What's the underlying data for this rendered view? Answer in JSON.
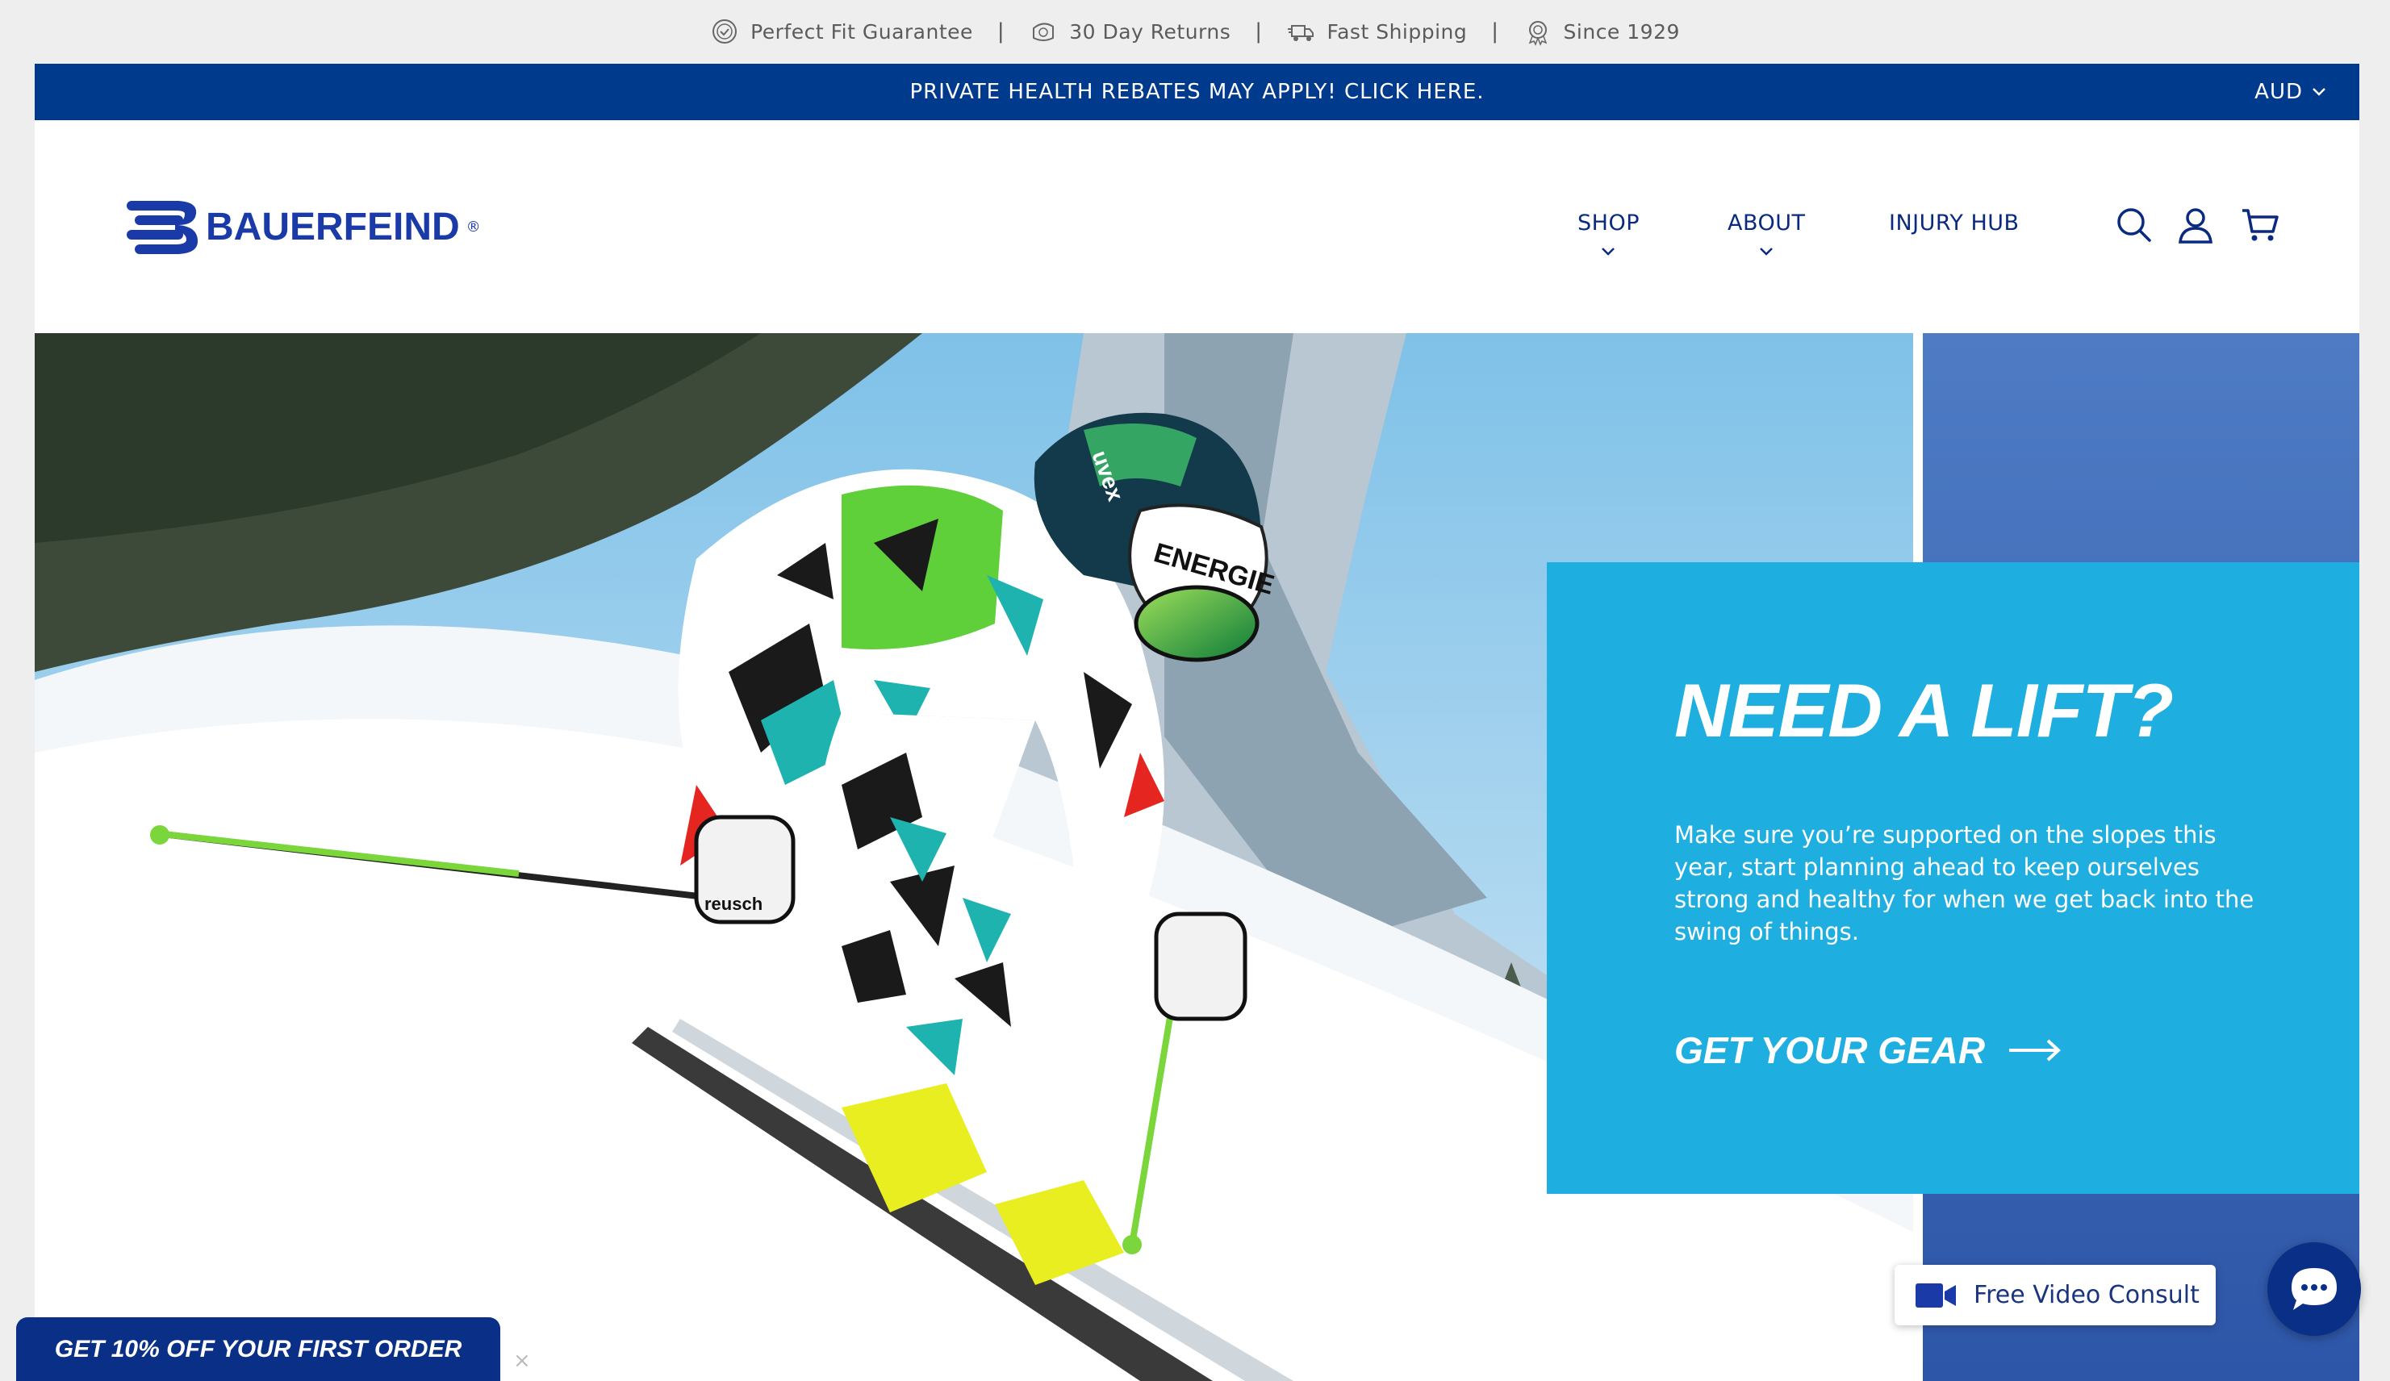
{
  "trust_bar": {
    "items": [
      {
        "label": "Perfect Fit Guarantee",
        "icon": "badge-check-icon"
      },
      {
        "label": "30 Day Returns",
        "icon": "returns-icon"
      },
      {
        "label": "Fast Shipping",
        "icon": "truck-icon"
      },
      {
        "label": "Since 1929",
        "icon": "award-icon"
      }
    ],
    "separator": "|"
  },
  "announcement": {
    "text": "PRIVATE HEALTH REBATES MAY APPLY! CLICK HERE.",
    "currency": "AUD"
  },
  "header": {
    "logo_text": "BAUERFEIND",
    "logo_mark": "®",
    "nav": [
      {
        "label": "SHOP",
        "has_dropdown": true
      },
      {
        "label": "ABOUT",
        "has_dropdown": true
      },
      {
        "label": "INJURY HUB",
        "has_dropdown": false
      }
    ],
    "icons": [
      "search-icon",
      "account-icon",
      "cart-icon"
    ]
  },
  "hero": {
    "title": "NEED A LIFT?",
    "body": "Make sure you’re supported on the slopes this year, start planning ahead to keep ourselves strong and healthy for when we get back into the swing of things.",
    "cta": "GET YOUR GEAR",
    "helmet_texts": [
      "uvex",
      "ENERGIE"
    ],
    "glove_text": "reusch",
    "colors": {
      "promo_bg": "#1eaee0",
      "brand_blue": "#003a8c"
    }
  },
  "widgets": {
    "video_consult": "Free Video Consult",
    "discount_tab": "GET 10% OFF YOUR FIRST ORDER",
    "discount_close": "×"
  }
}
